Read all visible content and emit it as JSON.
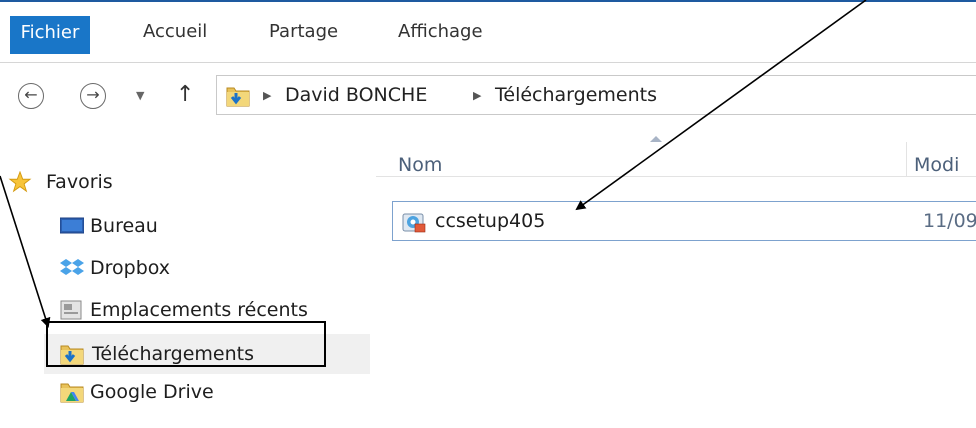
{
  "ribbon": {
    "tabs": [
      "Fichier",
      "Accueil",
      "Partage",
      "Affichage"
    ]
  },
  "address": {
    "crumbs": [
      "David BONCHE",
      "Téléchargements"
    ]
  },
  "nav": {
    "items": [
      {
        "label": "Favoris",
        "icon": "star-icon"
      },
      {
        "label": "Bureau",
        "icon": "desktop-icon"
      },
      {
        "label": "Dropbox",
        "icon": "dropbox-icon"
      },
      {
        "label": "Emplacements récents",
        "icon": "recent-places-icon"
      },
      {
        "label": "Téléchargements",
        "icon": "downloads-folder-icon"
      },
      {
        "label": "Google Drive",
        "icon": "google-drive-icon"
      }
    ]
  },
  "content": {
    "columns": [
      "Nom",
      "Modi"
    ],
    "files": [
      {
        "name": "ccsetup405",
        "date": "11/09",
        "icon": "installer-icon"
      }
    ]
  },
  "colors": {
    "file_tab": "#1976c8",
    "selection_border": "#7da2ce",
    "header_text": "#4c607a"
  }
}
